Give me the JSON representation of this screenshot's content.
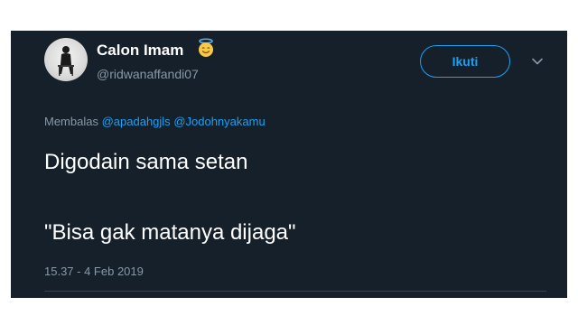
{
  "tweet": {
    "display_name": "Calon Imam",
    "name_emoji": "smiling-face-with-halo",
    "handle": "@ridwanaffandi07",
    "follow_label": "Ikuti",
    "reply_prefix": "Membalas",
    "mentions": [
      "@apadahgjls",
      "@Jodohnyakamu"
    ],
    "text_line_1": "Digodain sama setan",
    "text_line_2": "\"Bisa gak matanya dijaga\"",
    "timestamp": "15.37 - 4 Feb 2019"
  },
  "colors": {
    "background": "#15202b",
    "accent": "#1da1f2",
    "secondary_text": "#8899a6",
    "primary_text": "#ffffff"
  },
  "icons": {
    "menu": "chevron-down-icon"
  }
}
